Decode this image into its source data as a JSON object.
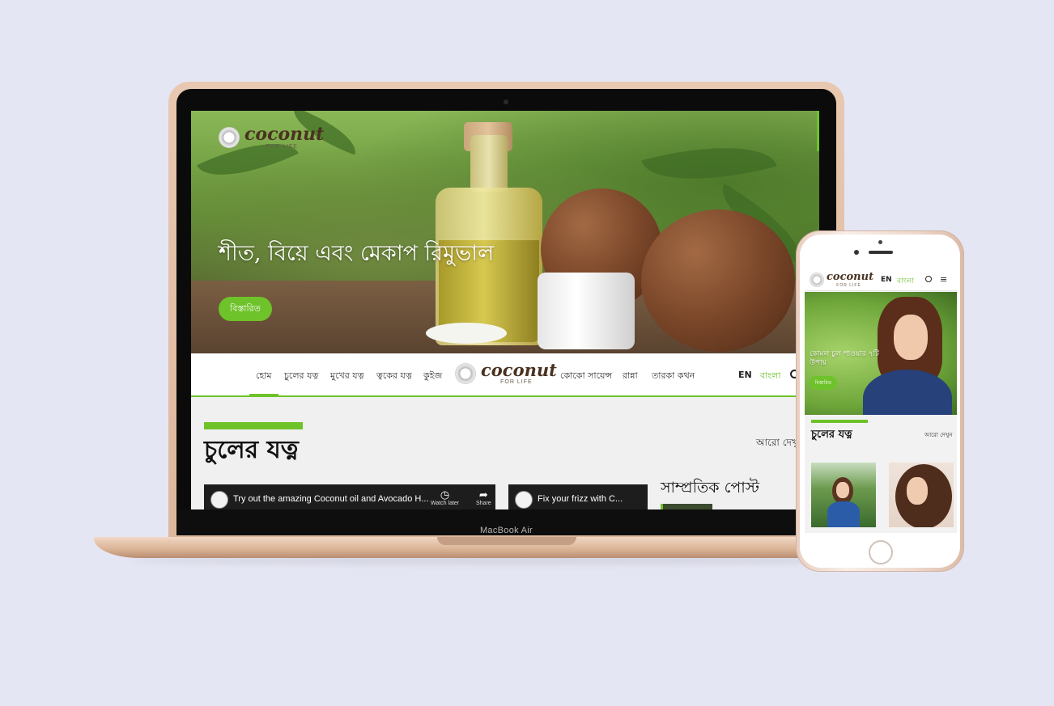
{
  "laptop": {
    "brand": "MacBook Air",
    "site": {
      "logo": {
        "name": "coconut",
        "sub": "FOR LIFE"
      },
      "hero": {
        "title": "শীত, বিয়ে এবং মেকাপ রিমুভাল",
        "button": "বিস্তারিত"
      },
      "nav": {
        "left_items": [
          "হোম",
          "চুলের যত্ন",
          "মুখের যত্ন",
          "ত্বকের যত্ন",
          "কুইজ"
        ],
        "right_items": [
          "কোকো সায়েন্স",
          "রান্না",
          "তারকা কথন"
        ],
        "active_item": "হোম",
        "lang_en": "EN",
        "lang_bn": "বাংলা"
      },
      "section": {
        "title": "চুলের যত্ন",
        "more": "আরো দেখুন"
      },
      "videos": [
        {
          "title": "Try out the amazing Coconut oil and Avocado H...",
          "watch_later": "Watch later",
          "share": "Share"
        },
        {
          "title": "Fix your frizz with C..."
        }
      ],
      "recent_posts": "সাম্প্রতিক পোস্ট"
    }
  },
  "phone": {
    "site": {
      "logo": {
        "name": "coconut",
        "sub": "FOR LIFE"
      },
      "lang_en": "EN",
      "lang_bn": "বাংলা",
      "hero": {
        "title": "কোমল চুল পাওয়ার ৭টি উপায়",
        "button": "বিস্তারিত"
      },
      "section": {
        "title": "চুলের যত্ন",
        "more": "আরো দেখুন"
      }
    }
  },
  "colors": {
    "accent": "#6ec22a",
    "background": "#e5e6f3",
    "device_gold": "#e3c2aa"
  }
}
